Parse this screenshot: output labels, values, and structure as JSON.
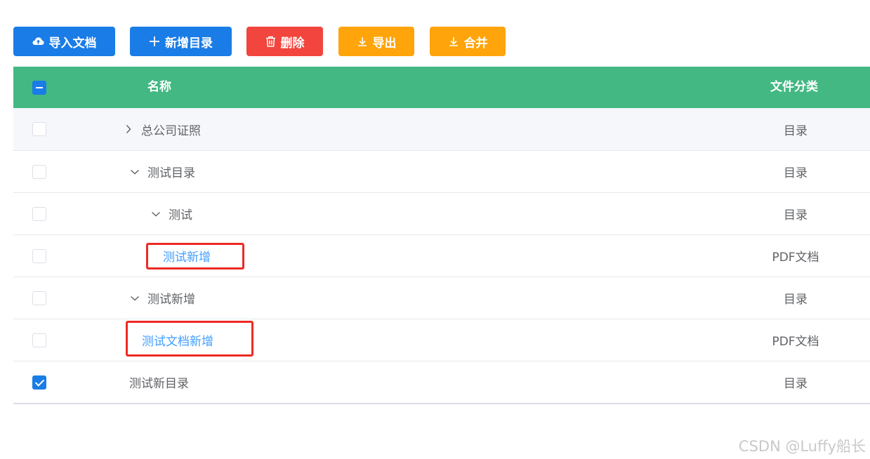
{
  "toolbar": {
    "import_label": "导入文档",
    "add_dir_label": "新增目录",
    "delete_label": "删除",
    "export_label": "导出",
    "merge_label": "合并",
    "colors": {
      "primary": "#1a7ce6",
      "danger": "#f2453d",
      "warning": "#ffa40a"
    }
  },
  "table": {
    "header_color": "#43b883",
    "columns": {
      "name": "名称",
      "type": "文件分类"
    },
    "select_all_state": "indeterminate",
    "rows": [
      {
        "name": "总公司证照",
        "type": "目录",
        "expander": "collapsed",
        "checked": false
      },
      {
        "name": "测试目录",
        "type": "目录",
        "expander": "expanded",
        "checked": false
      },
      {
        "name": "测试",
        "type": "目录",
        "expander": "expanded",
        "checked": false
      },
      {
        "name": "测试新增",
        "type": "PDF文档",
        "expander": "none",
        "checked": false,
        "link": true,
        "highlighted": true
      },
      {
        "name": "测试新增",
        "type": "目录",
        "expander": "expanded",
        "checked": false
      },
      {
        "name": "测试文档新增",
        "type": "PDF文档",
        "expander": "none",
        "checked": false,
        "link": true,
        "highlighted": true
      },
      {
        "name": "测试新目录",
        "type": "目录",
        "expander": "none",
        "checked": true
      }
    ]
  },
  "watermark": "CSDN @Luffy船长"
}
